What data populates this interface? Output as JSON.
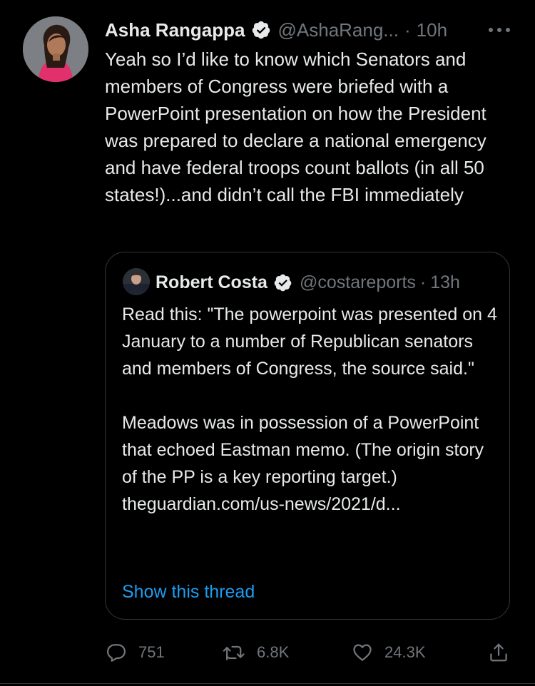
{
  "author": {
    "name": "Asha Rangappa",
    "handle": "@AshaRang...",
    "separator": "·",
    "time": "10h",
    "verified_icon": "verified-badge-icon"
  },
  "tweet": {
    "text": "Yeah so I’d like to know which Senators and members of Congress were briefed with a PowerPoint presentation on how the President was prepared to declare a national emergency and have federal troops count ballots (in all 50 states!)...and didn’t call the FBI immediately"
  },
  "quoted": {
    "name": "Robert Costa",
    "handle": "@costareports",
    "separator": "·",
    "time": "13h",
    "text": "Read this: \"The powerpoint was presented on 4 January to a number of Republican senators and members of Congress, the source said.\"\n\nMeadows was in possession of a PowerPoint that echoed Eastman memo. (The origin story of the PP is a key reporting target.)",
    "link": "theguardian.com/us-news/2021/d...",
    "show_thread": "Show this thread"
  },
  "actions": {
    "replies": "751",
    "retweets": "6.8K",
    "likes": "24.3K"
  },
  "colors": {
    "background": "#000000",
    "text": "#e7e9ea",
    "secondary": "#71767b",
    "link": "#1d9bf0",
    "verified": "#e7e9ea"
  }
}
